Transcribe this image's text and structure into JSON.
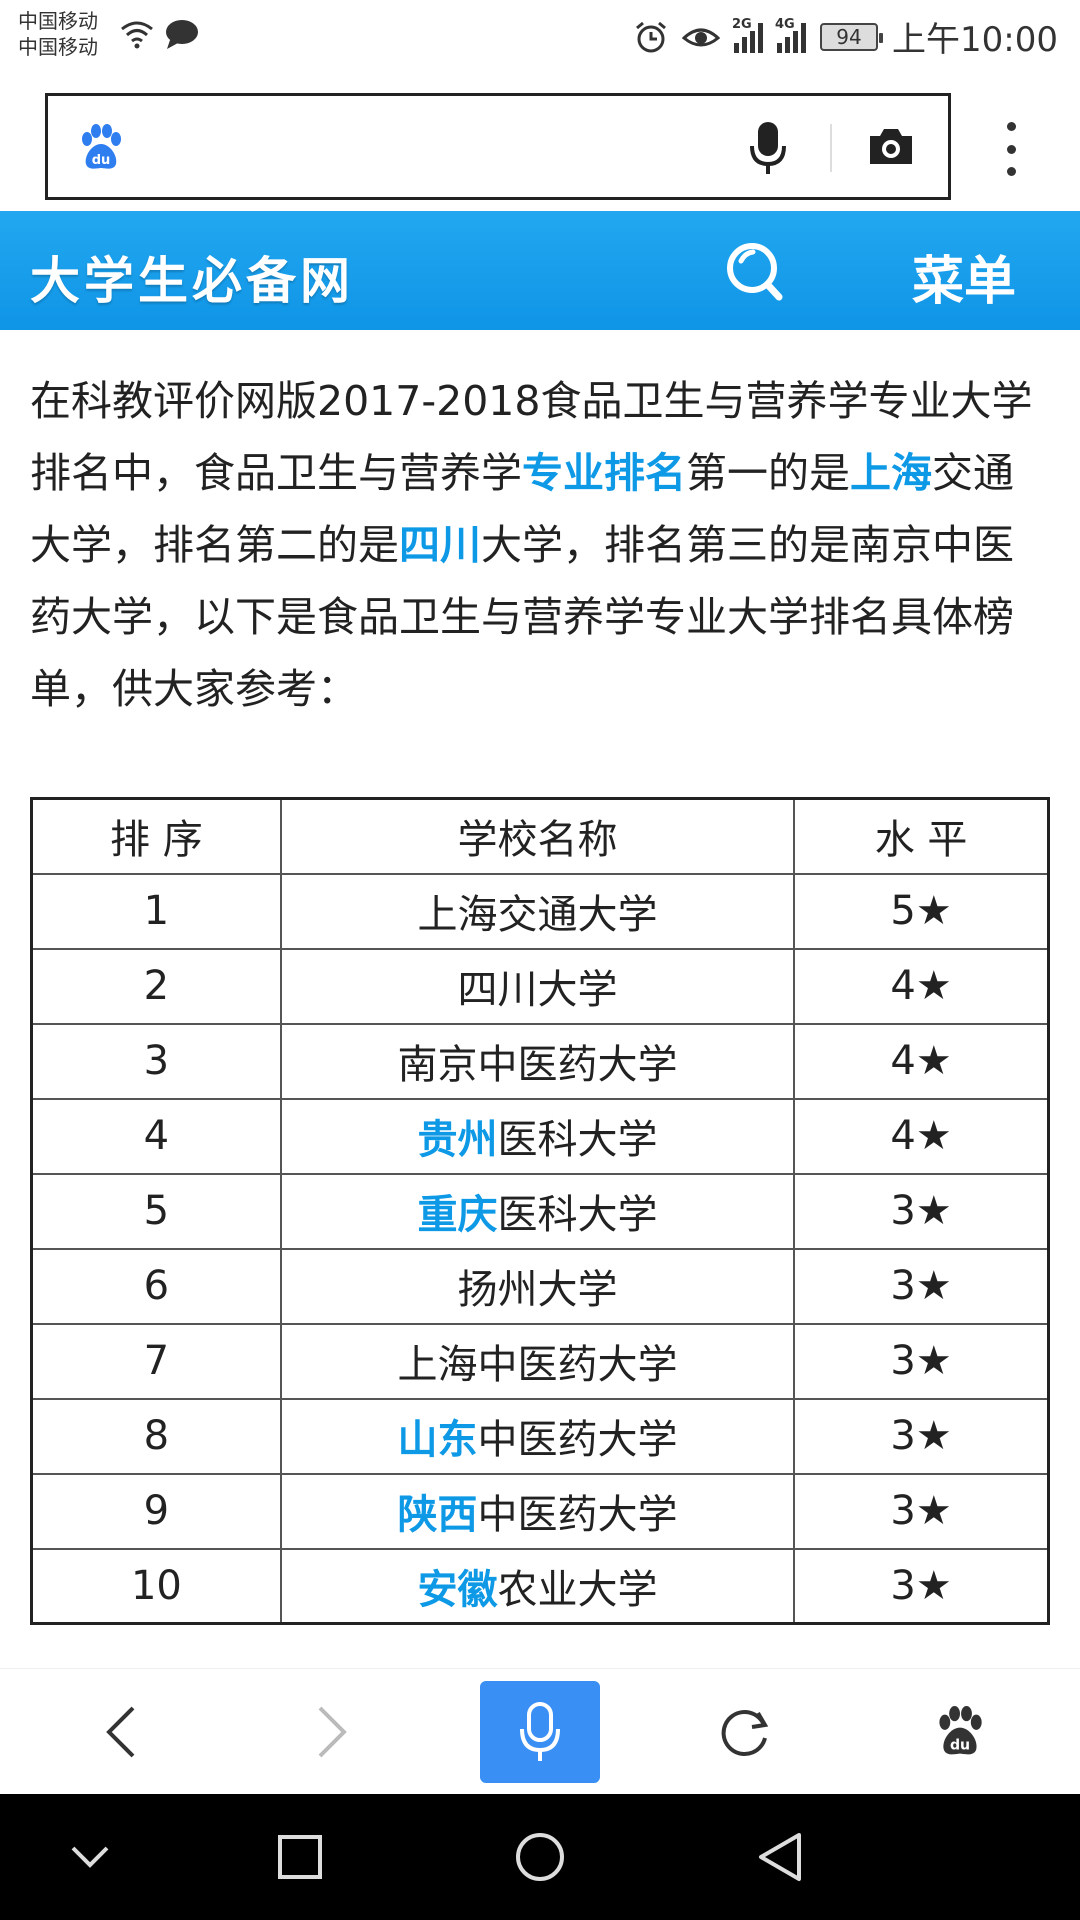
{
  "status_bar": {
    "carrier_1": "中国移动",
    "carrier_2": "中国移动",
    "network_1": "2G",
    "network_2": "4G",
    "battery": "94",
    "time": "上午10:00"
  },
  "browser": {
    "search_placeholder": ""
  },
  "site": {
    "logo_text": "大学生必备网",
    "menu_label": "菜单"
  },
  "article": {
    "p1": "在科教评价网版2017-2018食品卫生与营养学专业大学排名中，食品卫生与营养学",
    "link_ranking": "专业排名",
    "p2": "第一的是",
    "link_shanghai": "上海",
    "p3": "交通大学，排名第二的是",
    "link_sichuan": "四川",
    "p4": "大学，排名第三的是南京中医药大学，以下是食品卫生与营养学专业大学排名具体榜单，供大家参考："
  },
  "table": {
    "headers": [
      "排 序",
      "学校名称",
      "水 平"
    ],
    "rows": [
      {
        "rank": "1",
        "hl": "",
        "name": "上海交通大学",
        "level": "5★"
      },
      {
        "rank": "2",
        "hl": "",
        "name": "四川大学",
        "level": "4★"
      },
      {
        "rank": "3",
        "hl": "",
        "name": "南京中医药大学",
        "level": "4★"
      },
      {
        "rank": "4",
        "hl": "贵州",
        "name": "医科大学",
        "level": "4★"
      },
      {
        "rank": "5",
        "hl": "重庆",
        "name": "医科大学",
        "level": "3★"
      },
      {
        "rank": "6",
        "hl": "",
        "name": "扬州大学",
        "level": "3★"
      },
      {
        "rank": "7",
        "hl": "",
        "name": "上海中医药大学",
        "level": "3★"
      },
      {
        "rank": "8",
        "hl": "山东",
        "name": "中医药大学",
        "level": "3★"
      },
      {
        "rank": "9",
        "hl": "陕西",
        "name": "中医药大学",
        "level": "3★"
      },
      {
        "rank": "10",
        "hl": "安徽",
        "name": "农业大学",
        "level": "3★"
      }
    ]
  },
  "colors": {
    "accent": "#0d99e6",
    "header_blue": "#1a9fef",
    "voice_button": "#3a8ff5"
  }
}
